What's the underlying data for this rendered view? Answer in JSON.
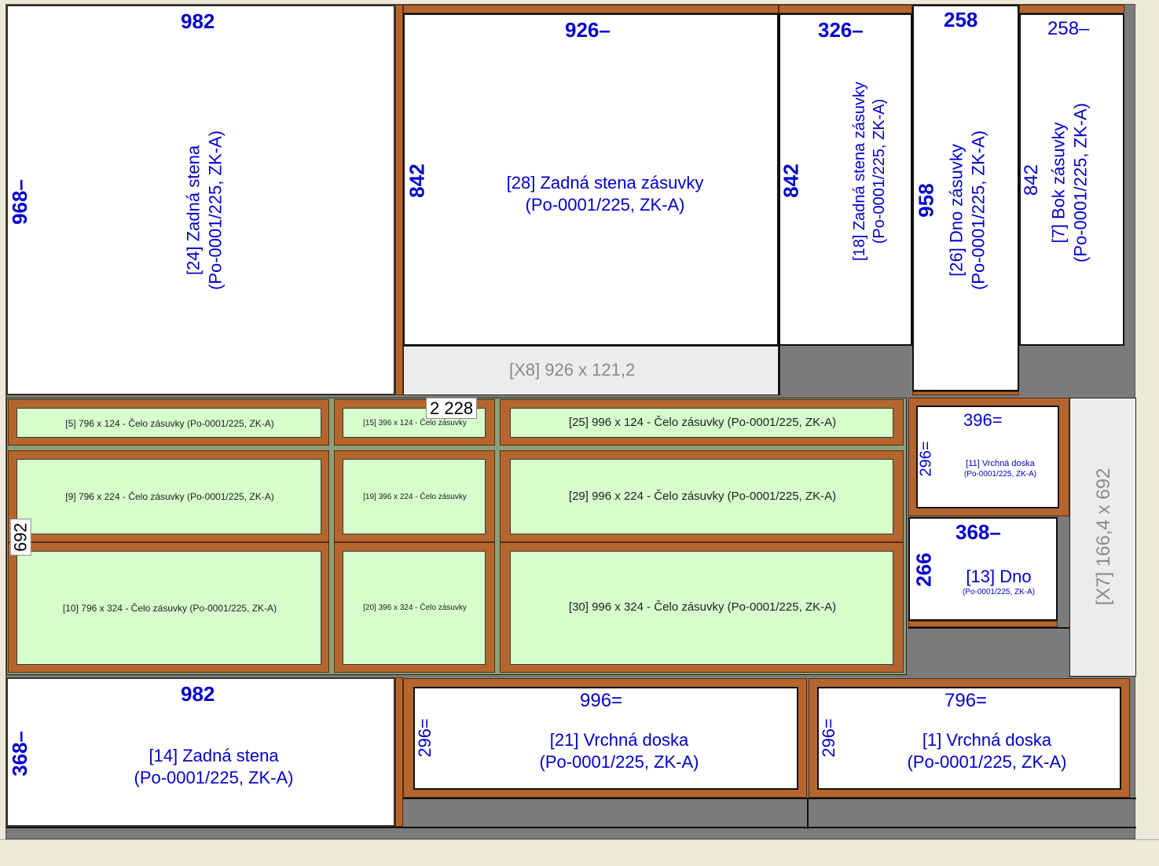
{
  "colors": {
    "edge_band": "#b5662e",
    "front_fill": "#d6ffcc",
    "sheet": "#7b7b7b",
    "waste": "#ececec",
    "dim_text": "#0000cc"
  },
  "parts": {
    "p24": {
      "width_dim": "982",
      "height_dim": "968–",
      "label1": "[24]  Zadná stena",
      "label2": "(Po-0001/225, ZK-A)"
    },
    "p28": {
      "width_dim": "926–",
      "height_dim": "842",
      "label1": "[28]  Zadná stena zásuvky",
      "label2": "(Po-0001/225, ZK-A)"
    },
    "p18": {
      "width_dim": "326–",
      "height_dim": "842",
      "label1": "[18]  Zadná stena zásuvky",
      "label2": "(Po-0001/225, ZK-A)"
    },
    "p26": {
      "width_dim": "258",
      "height_dim": "958",
      "label1": "[26]  Dno zásuvky",
      "label2": "(Po-0001/225, ZK-A)"
    },
    "p7": {
      "width_dim": "258–",
      "height_dim": "842",
      "label1": "[7]  Bok zásuvky",
      "label2": "(Po-0001/225, ZK-A)"
    },
    "x8": {
      "label": "[X8]  926 x 121,2"
    },
    "x7": {
      "label": "[X7]  166,4 x 692"
    },
    "p11": {
      "width_dim": "396=",
      "height_dim": "296=",
      "label1": "[11]  Vrchná doska",
      "label2": "(Po-0001/225, ZK-A)"
    },
    "p13": {
      "width_dim": "368–",
      "height_dim": "266",
      "label1": "[13]  Dno",
      "label2": "(Po-0001/225, ZK-A)"
    },
    "p14": {
      "width_dim": "982",
      "height_dim": "368–",
      "label1": "[14]  Zadná stena",
      "label2": "(Po-0001/225, ZK-A)"
    },
    "p21": {
      "width_dim": "996=",
      "height_dim": "296=",
      "label1": "[21]  Vrchná doska",
      "label2": "(Po-0001/225, ZK-A)"
    },
    "p1": {
      "width_dim": "796=",
      "height_dim": "296=",
      "label1": "[1]  Vrchná doska",
      "label2": "(Po-0001/225, ZK-A)"
    }
  },
  "fronts_group": {
    "width_tag": "2 228",
    "height_tag": "692",
    "fronts": {
      "f5": "[5]  796 x 124 - Čelo zásuvky  (Po-0001/225, ZK-A)",
      "f15": "[15]  396 x 124 - Čelo zásuvky",
      "f25": "[25]  996 x 124 - Čelo zásuvky  (Po-0001/225, ZK-A)",
      "f9": "[9]  796 x 224 - Čelo zásuvky  (Po-0001/225, ZK-A)",
      "f19": "[19]  396 x 224 - Čelo zásuvky",
      "f29": "[29]  996 x 224 - Čelo zásuvky  (Po-0001/225, ZK-A)",
      "f10": "[10]  796 x 324 - Čelo zásuvky  (Po-0001/225, ZK-A)",
      "f20": "[20]  396 x 324 - Čelo zásuvky",
      "f30": "[30]  996 x 324 - Čelo zásuvky  (Po-0001/225, ZK-A)"
    }
  }
}
